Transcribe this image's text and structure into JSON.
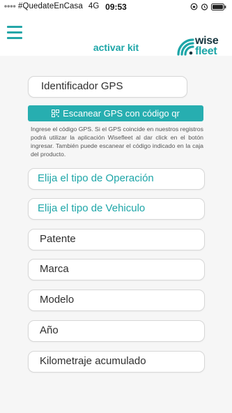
{
  "status_bar": {
    "carrier": "#QuedateEnCasa",
    "network": "4G",
    "time": "09:53"
  },
  "header": {
    "title": "activar kit",
    "logo_top": "wise",
    "logo_bottom": "fleet"
  },
  "form": {
    "gps_placeholder": "Identificador GPS",
    "scan_button": "Escanear GPS con código qr",
    "help_text": "Ingrese el código GPS. Si el GPS coincide en nuestros registros podrá utilizar la aplicación Wisefleet al dar click en el botón ingresar. También puede escanear el código indicado en la caja del producto.",
    "operation_select": "Elija el tipo de Operación",
    "vehicle_select": "Elija el tipo de Vehiculo",
    "patente": "Patente",
    "marca": "Marca",
    "modelo": "Modelo",
    "anio": "Año",
    "kilometraje": "Kilometraje acumulado"
  },
  "colors": {
    "accent": "#1ea6a8",
    "button": "#27aeb0",
    "logo_dark": "#16363f"
  }
}
